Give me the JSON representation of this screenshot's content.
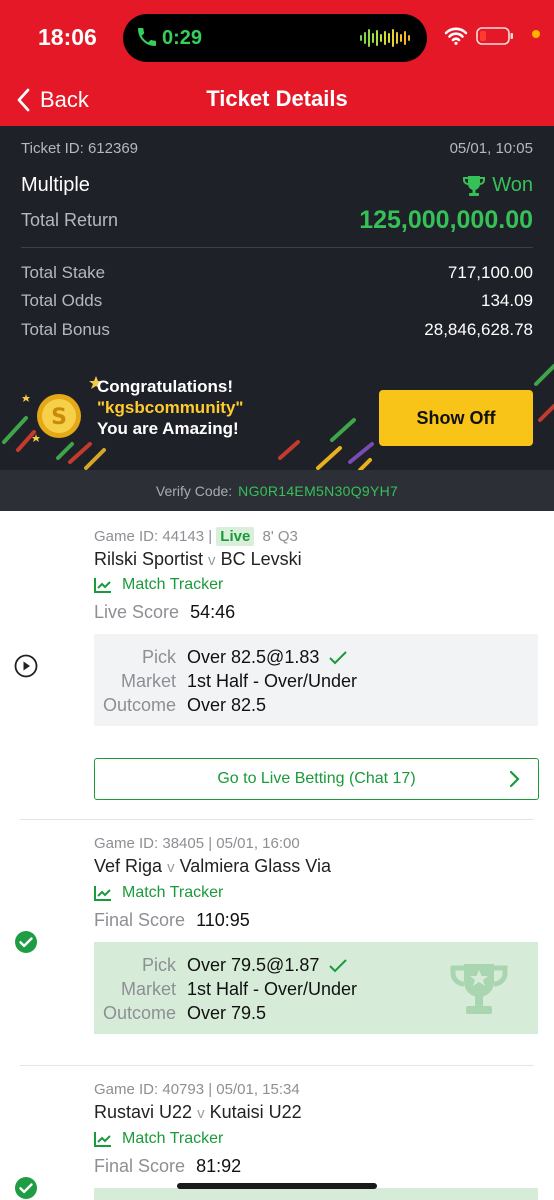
{
  "status_bar": {
    "time": "18:06",
    "call_timer": "0:29"
  },
  "nav": {
    "back_label": "Back",
    "title": "Ticket Details"
  },
  "ticket": {
    "id_label": "Ticket ID: 612369",
    "datetime": "05/01, 10:05",
    "type": "Multiple",
    "status": "Won",
    "total_return_label": "Total Return",
    "total_return": "125,000,000.00",
    "stake_label": "Total Stake",
    "stake": "717,100.00",
    "odds_label": "Total Odds",
    "odds": "134.09",
    "bonus_label": "Total Bonus",
    "bonus": "28,846,628.78"
  },
  "banner": {
    "line1": "Congratulations!",
    "line2": "\"kgsbcommunity\"",
    "line3": "You are Amazing!",
    "button": "Show Off"
  },
  "verify": {
    "label": "Verify Code:",
    "code": "NG0R14EM5N30Q9YH7"
  },
  "games": [
    {
      "id_prefix": "Game ID: 44143 |",
      "live_badge": "Live",
      "time": "8' Q3",
      "home": "Rilski Sportist",
      "vs": "v",
      "away": "BC Levski",
      "tracker": "Match Tracker",
      "score_label": "Live Score",
      "score": "54:46",
      "pick_label": "Pick",
      "pick": "Over 82.5@1.83",
      "market_label": "Market",
      "market": "1st Half - Over/Under",
      "outcome_label": "Outcome",
      "outcome": "Over 82.5",
      "live_button": "Go to Live Betting (Chat 17)"
    },
    {
      "id_line": "Game ID: 38405 | 05/01, 16:00",
      "home": "Vef Riga",
      "vs": "v",
      "away": "Valmiera Glass Via",
      "tracker": "Match Tracker",
      "score_label": "Final Score",
      "score": "110:95",
      "pick_label": "Pick",
      "pick": "Over 79.5@1.87",
      "market_label": "Market",
      "market": "1st Half - Over/Under",
      "outcome_label": "Outcome",
      "outcome": "Over 79.5"
    },
    {
      "id_line": "Game ID: 40793 | 05/01, 15:34",
      "home": "Rustavi U22",
      "vs": "v",
      "away": "Kutaisi U22",
      "tracker": "Match Tracker",
      "score_label": "Final Score",
      "score": "81:92"
    }
  ],
  "colors": {
    "brand_red": "#e41826",
    "win_green": "#35c158",
    "dark_bg": "#1e2127",
    "accent_yellow": "#f7c417"
  }
}
